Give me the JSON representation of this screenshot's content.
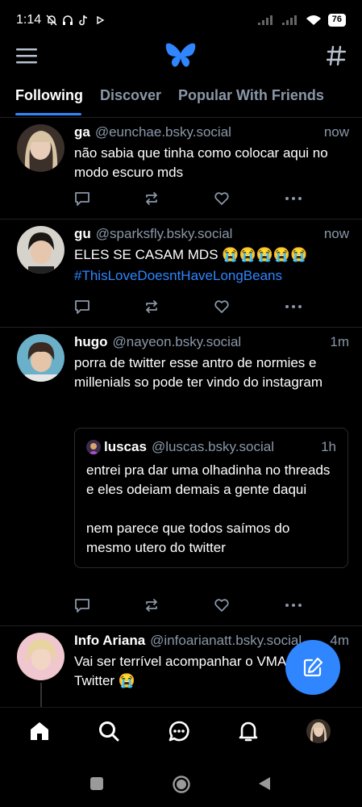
{
  "status": {
    "time": "1:14",
    "battery": "76",
    "icons": [
      "mute-icon",
      "headphones-icon",
      "tiktok-icon",
      "play-icon",
      "signal-icon",
      "signal-icon",
      "wifi-icon",
      "battery-icon"
    ]
  },
  "header": {
    "menu_icon": "menu-icon",
    "logo_icon": "butterfly-logo-icon",
    "feeds_icon": "hashtag-icon"
  },
  "tabs": [
    {
      "label": "Following",
      "active": true
    },
    {
      "label": "Discover",
      "active": false
    },
    {
      "label": "Popular With Friends",
      "active": false
    }
  ],
  "posts": [
    {
      "name": "ga",
      "handle": "@eunchae.bsky.social",
      "time": "now",
      "text": "não sabia que tinha como colocar aqui no modo escuro mds"
    },
    {
      "name": "gu",
      "handle": "@sparksfly.bsky.social",
      "time": "now",
      "text": "ELES SE CASAM MDS 😭😭😭😭😭",
      "link": "#ThisLoveDoesntHaveLongBeans"
    },
    {
      "name": "hugo",
      "handle": "@nayeon.bsky.social",
      "time": "1m",
      "text": "porra de twitter esse antro de normies e millenials so pode ter vindo do instagram",
      "quote": {
        "name": "luscas",
        "handle": "@luscas.bsky.social",
        "time": "1h",
        "text": "entrei pra dar uma olhadinha no threads e eles odeiam demais a gente daqui\n\nnem parece que todos saímos do mesmo utero do twitter"
      }
    },
    {
      "name": "Info Ariana",
      "handle": "@infoarianatt.bsky.social",
      "time": "4m",
      "text": "Vai ser terrível acompanhar o VMA sem Twitter 😭"
    }
  ],
  "nav": [
    "home-icon",
    "search-icon",
    "chat-icon",
    "bell-icon",
    "profile-avatar"
  ],
  "colors": {
    "accent": "#2f86ff",
    "muted": "#8a97a8",
    "background": "#000000"
  }
}
